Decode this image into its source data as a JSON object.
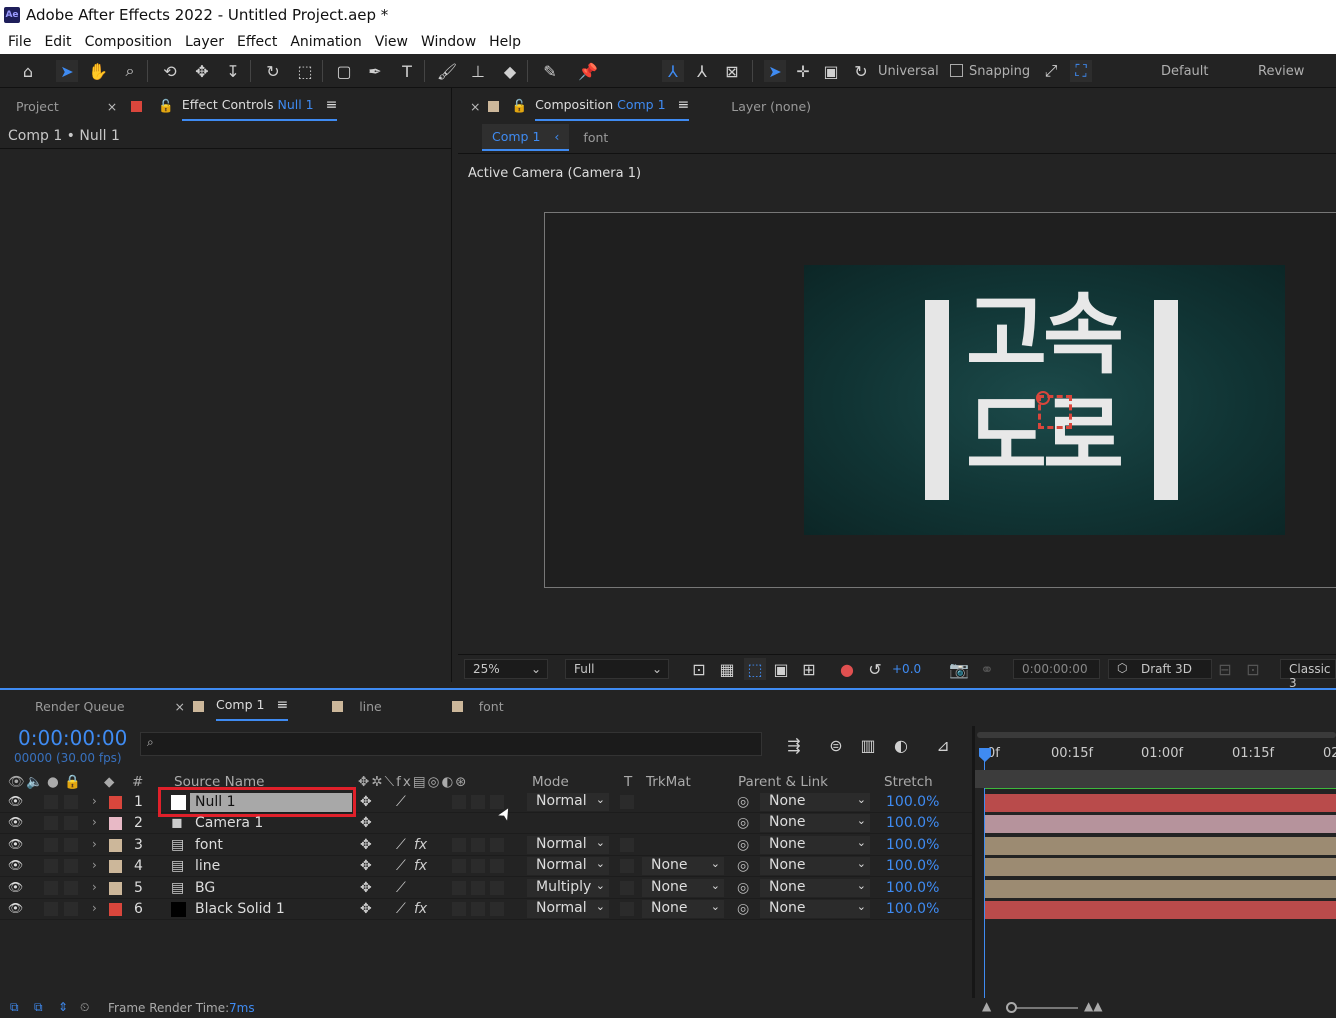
{
  "app": {
    "title": "Adobe After Effects 2022 - Untitled Project.aep *",
    "logo": "Ae"
  },
  "menu": [
    "File",
    "Edit",
    "Composition",
    "Layer",
    "Effect",
    "Animation",
    "View",
    "Window",
    "Help"
  ],
  "toolbar": {
    "icons": [
      "home-icon",
      "selection-arrow-icon",
      "hand-icon",
      "zoom-icon",
      "orbit-camera-icon",
      "pan-camera-icon",
      "dolly-camera-icon",
      "rotate-icon",
      "pan-behind-icon",
      "rectangle-icon",
      "pen-icon",
      "type-icon",
      "brush-icon",
      "clone-stamp-icon",
      "eraser-icon",
      "roto-brush-icon",
      "puppet-pin-icon"
    ],
    "axis_label": "Universal",
    "snapping_label": "Snapping",
    "workspaces": [
      "Default",
      "Review"
    ]
  },
  "project_panel": {
    "tab_project": "Project",
    "tab_effect_controls": "Effect Controls",
    "tab_effect_controls_target": "Null 1",
    "breadcrumb": "Comp 1 • Null 1",
    "swatch_color": "#d9463c"
  },
  "comp_panel": {
    "tab_composition": "Composition",
    "tab_composition_target": "Comp 1",
    "tab_layer": "Layer (none)",
    "subtab_active": "Comp 1",
    "subtab_other": "font",
    "camera_label": "Active Camera (Camera 1)",
    "scene_text_top": "고속",
    "scene_text_bottom": "도로",
    "zoom": "25%",
    "resolution": "Full",
    "exposure": "+0.0",
    "timecode": "0:00:00:00",
    "renderer": "Draft 3D",
    "mode3d": "Classic 3"
  },
  "timeline": {
    "tabs": [
      "Render Queue",
      "Comp 1",
      "line",
      "font"
    ],
    "tab_colors": [
      "#ccb79a",
      "#ccb79a",
      "#ccb79a"
    ],
    "timecode": "0:00:00:00",
    "frames": "00000 (30.00 fps)",
    "search_placeholder": "",
    "headers": {
      "num": "#",
      "source": "Source Name",
      "mode": "Mode",
      "t": "T",
      "trkmat": "TrkMat",
      "parent": "Parent & Link",
      "stretch": "Stretch"
    },
    "ruler": [
      "0f",
      "00:15f",
      "01:00f",
      "01:15f",
      "02"
    ],
    "layers": [
      {
        "num": "1",
        "name": "Null 1",
        "label_color": "#d9463c",
        "mode": "Normal",
        "trkmat": "",
        "parent": "None",
        "stretch": "100.0%",
        "bar_color": "#b94b4b",
        "has_fx": false,
        "selected": true
      },
      {
        "num": "2",
        "name": "Camera 1",
        "label_color": "#e8b9c6",
        "mode": "",
        "trkmat": "",
        "parent": "None",
        "stretch": "100.0%",
        "bar_color": "#b6939c",
        "has_fx": false,
        "selected": false
      },
      {
        "num": "3",
        "name": "font",
        "label_color": "#ccb79a",
        "mode": "Normal",
        "trkmat": "",
        "parent": "None",
        "stretch": "100.0%",
        "bar_color": "#9c8b72",
        "has_fx": true,
        "selected": false
      },
      {
        "num": "4",
        "name": "line",
        "label_color": "#ccb79a",
        "mode": "Normal",
        "trkmat": "None",
        "parent": "None",
        "stretch": "100.0%",
        "bar_color": "#9c8b72",
        "has_fx": true,
        "selected": false
      },
      {
        "num": "5",
        "name": "BG",
        "label_color": "#ccb79a",
        "mode": "Multiply",
        "trkmat": "None",
        "parent": "None",
        "stretch": "100.0%",
        "bar_color": "#9c8b72",
        "has_fx": false,
        "selected": false
      },
      {
        "num": "6",
        "name": "Black Solid 1",
        "label_color": "#d9463c",
        "mode": "Normal",
        "trkmat": "None",
        "parent": "None",
        "stretch": "100.0%",
        "bar_color": "#b94b4b",
        "has_fx": true,
        "selected": false
      }
    ],
    "status_label": "Frame Render Time:",
    "status_value": "7ms"
  }
}
